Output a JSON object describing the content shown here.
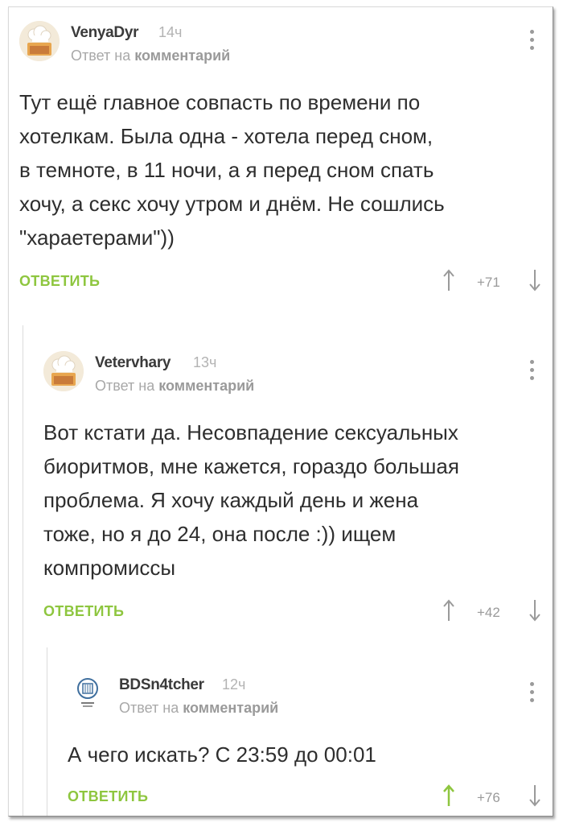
{
  "comments": [
    {
      "username": "VenyaDyr",
      "time": "14ч",
      "reply_prefix": "Ответ на",
      "reply_target": "комментарий",
      "text_lines": [
        "Тут ещё главное совпасть по времени по",
        "хотелкам. Была одна - хотела перед сном,",
        "в темноте, в 11 ночи, а я перед сном спать",
        "хочу, а секс хочу утром и днём. Не сошлись",
        "\"хараетерами\"))"
      ],
      "reply_label": "ОТВЕТИТЬ",
      "rating": "+71",
      "avatar_icon": "chef-hat-avatar-icon"
    },
    {
      "username": "Vetervhary",
      "time": "13ч",
      "reply_prefix": "Ответ на",
      "reply_target": "комментарий",
      "text_lines": [
        "Вот кстати да. Несовпадение сексуальных",
        "биоритмов, мне кажется, гораздо большая",
        "проблема. Я хочу каждый день и жена",
        "тоже, но я до 24, она после :)) ищем",
        "компромиссы"
      ],
      "reply_label": "ОТВЕТИТЬ",
      "rating": "+42",
      "avatar_icon": "chef-hat-avatar-icon"
    },
    {
      "username": "BDSn4tcher",
      "time": "12ч",
      "reply_prefix": "Ответ на",
      "reply_target": "комментарий",
      "text_lines": [
        "А чего искать? С 23:59 до 00:01"
      ],
      "reply_label": "ОТВЕТИТЬ",
      "rating": "+76",
      "avatar_icon": "university-emblem-avatar-icon",
      "upvoted": true
    }
  ],
  "colors": {
    "accent_green": "#8ec63f",
    "text": "#2e2e2e",
    "muted": "#a8a8a8",
    "thread_line": "#dcdcdc"
  }
}
